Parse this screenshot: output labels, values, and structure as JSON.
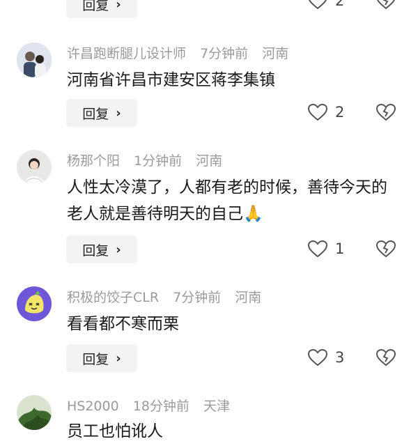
{
  "reply_label": "回复",
  "top_partial": {
    "like_count": "2"
  },
  "comments": [
    {
      "username": "许昌跑断腿儿设计师",
      "time": "7分钟前",
      "location": "河南",
      "text": "河南省许昌市建安区蒋李集镇",
      "like_count": "2",
      "avatar": "avatar-photo-couple"
    },
    {
      "username": "杨那个阳",
      "time": "1分钟前",
      "location": "河南",
      "text": "人性太冷漠了，人都有老的时候，善待今天的老人就是善待明天的自己🙏",
      "like_count": "1",
      "avatar": "avatar-photo-woman"
    },
    {
      "username": "积极的饺子CLR",
      "time": "7分钟前",
      "location": "河南",
      "text": "看看都不寒而栗",
      "like_count": "3",
      "avatar": "avatar-cartoon-dumpling"
    },
    {
      "username": "HS2000",
      "time": "18分钟前",
      "location": "天津",
      "text": "员工也怕讹人",
      "like_count": "",
      "avatar": "avatar-photo-plant"
    }
  ],
  "colors": {
    "meta_text": "#9a9a9a",
    "body_text": "#1a1a1a",
    "reply_bg": "#f3f3f3",
    "icon_stroke": "#555555"
  }
}
